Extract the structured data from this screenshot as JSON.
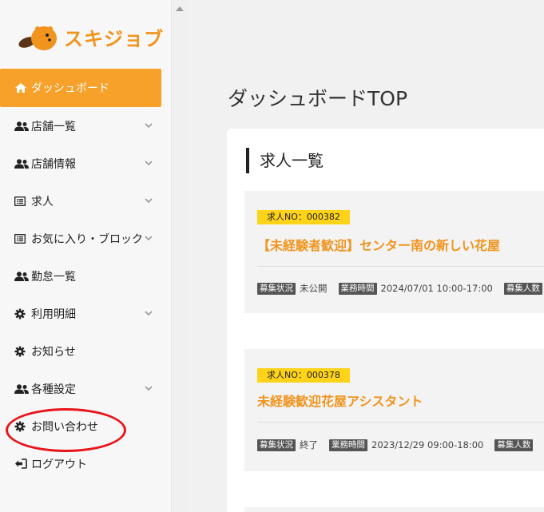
{
  "brand": {
    "name": "スキジョブ",
    "color": "#f0941e"
  },
  "sidebar": {
    "items": [
      {
        "label": "ダッシュボード",
        "icon": "home-icon",
        "active": true,
        "chevron": false
      },
      {
        "label": "店舗一覧",
        "icon": "users-icon",
        "chevron": true
      },
      {
        "label": "店舗情報",
        "icon": "users-icon",
        "chevron": true
      },
      {
        "label": "求人",
        "icon": "list-icon",
        "chevron": true
      },
      {
        "label": "お気に入り・ブロック",
        "icon": "list-icon",
        "chevron": true
      },
      {
        "label": "勤怠一覧",
        "icon": "users-icon",
        "chevron": false
      },
      {
        "label": "利用明細",
        "icon": "gear-icon",
        "chevron": true
      },
      {
        "label": "お知らせ",
        "icon": "gear-icon",
        "chevron": false
      },
      {
        "label": "各種設定",
        "icon": "users-icon",
        "chevron": true
      },
      {
        "label": "お問い合わせ",
        "icon": "gear-icon",
        "chevron": false
      },
      {
        "label": "ログアウト",
        "icon": "logout-icon",
        "chevron": false
      }
    ]
  },
  "main": {
    "page_title": "ダッシュボードTOP",
    "section_title": "求人一覧",
    "jobs": [
      {
        "no_label": "求人NO：000382",
        "title": "【未経験者歓迎】センター南の新しい花屋",
        "status_tag": "募集状況",
        "status_value": "未公開",
        "time_tag": "業務時間",
        "time_value": "2024/07/01 10:00-17:00",
        "count_tag": "募集人数"
      },
      {
        "no_label": "求人NO：000378",
        "title": "未経験歓迎花屋アシスタント",
        "status_tag": "募集状況",
        "status_value": "終了",
        "time_tag": "業務時間",
        "time_value": "2023/12/29 09:00-18:00",
        "count_tag": "募集人数"
      }
    ]
  },
  "colors": {
    "accent": "#f7a12a",
    "badge": "#ffd31a",
    "annotation": "#e8141a"
  }
}
